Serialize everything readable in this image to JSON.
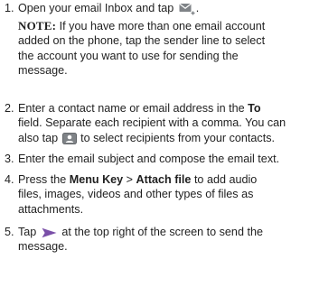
{
  "steps": [
    {
      "number": "1.",
      "text_before": "Open your email Inbox and tap",
      "text_after": ".",
      "icon": "email-compose-icon",
      "note": {
        "label": "NOTE:",
        "lines": [
          "If you have more than one email account",
          "added on the phone, tap the sender line to select",
          "the account you want to use for sending the",
          "message."
        ]
      }
    },
    {
      "number": "2.",
      "line1_prefix": "Enter a contact name or email address in the",
      "line1_bold": "To",
      "line2": "field. Separate each recipient with a comma. You can",
      "line3_before": "also tap",
      "line3_after": "to select recipients from your contacts.",
      "icon": "contact-picker-icon"
    },
    {
      "number": "3.",
      "text": "Enter the email subject and compose the email text."
    },
    {
      "number": "4.",
      "line1_prefix": "Press the",
      "line1_bold1": "Menu Key",
      "line1_sep": " > ",
      "line1_bold2": "Attach file",
      "line1_suffix": "to add audio",
      "line2": "files, images, videos and other types of files as",
      "line3": "attachments."
    },
    {
      "number": "5.",
      "line1_before": "Tap",
      "line1_after": "at the top right of the screen to send the",
      "line2": "message.",
      "icon": "send-icon"
    }
  ],
  "colors": {
    "text": "#1f1f1f",
    "icon_gray": "#7f8387",
    "icon_dark": "#4a4e52",
    "send_purple": "#7a4fa8"
  }
}
